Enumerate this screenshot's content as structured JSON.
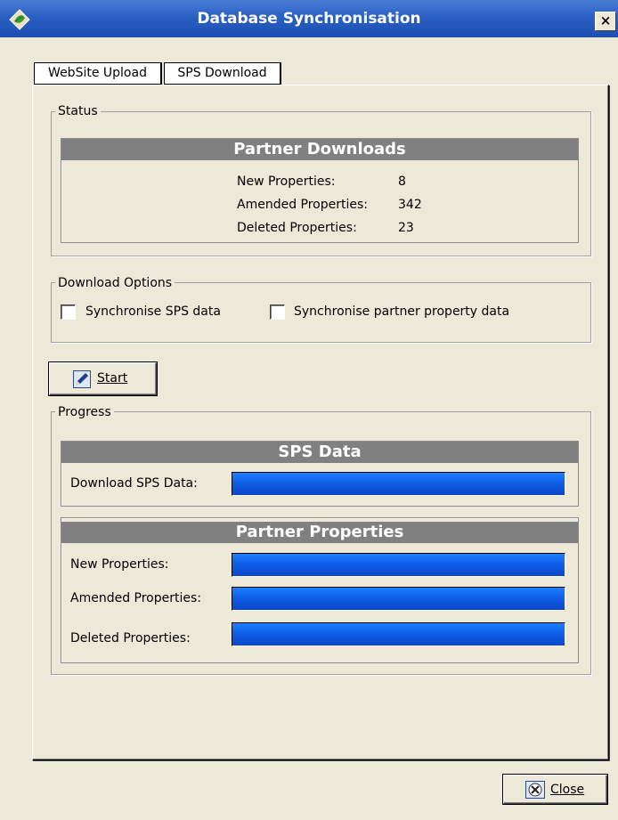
{
  "window": {
    "title": "Database Synchronisation",
    "close_glyph": "×",
    "icon": "app-leaf-icon"
  },
  "tabs": [
    {
      "label": "WebSite Upload",
      "active": false
    },
    {
      "label": "SPS Download",
      "active": true
    }
  ],
  "status": {
    "legend": "Status",
    "header": "Partner Downloads",
    "rows": [
      {
        "label": "New Properties:",
        "value": "8"
      },
      {
        "label": "Amended Properties:",
        "value": "342"
      },
      {
        "label": "Deleted Properties:",
        "value": "23"
      }
    ]
  },
  "options": {
    "legend": "Download Options",
    "items": [
      {
        "label": "Synchronise SPS data",
        "checked": false
      },
      {
        "label": "Synchronise partner property data",
        "checked": false
      }
    ]
  },
  "start_button": {
    "label": "Start",
    "icon": "pencil-icon"
  },
  "progress": {
    "legend": "Progress",
    "sps_header": "SPS Data",
    "sps_rows": [
      {
        "label": "Download SPS Data:",
        "progress": 1.0
      }
    ],
    "partner_header": "Partner Properties",
    "partner_rows": [
      {
        "label": "New Properties:",
        "progress": 1.0
      },
      {
        "label": "Amended Properties:",
        "progress": 1.0
      },
      {
        "label": "Deleted Properties:",
        "progress": 1.0
      }
    ]
  },
  "close_button": {
    "label": "Close",
    "icon": "close-cross-icon"
  },
  "colors": {
    "titlebar": "#2a5fc4",
    "section_header": "#808080",
    "progress_fill": "#0f5fe8",
    "window_bg": "#ece9d8"
  }
}
